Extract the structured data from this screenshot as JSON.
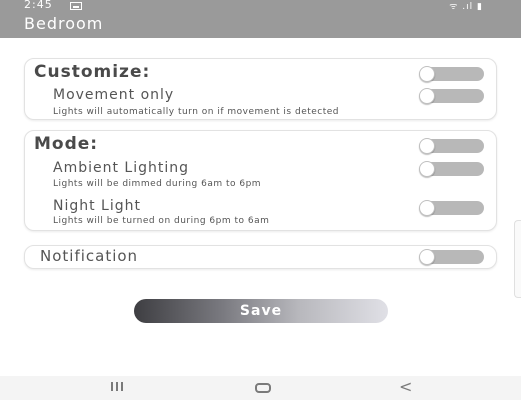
{
  "status_bar": {
    "time": "2:45",
    "right_icons": "ᯤ .ıl ▮"
  },
  "app_bar": {
    "title": "Bedroom"
  },
  "customize": {
    "title": "Customize:",
    "title_toggle_on": false,
    "movement": {
      "label": "Movement only",
      "description": "Lights will automatically turn on if movement is detected",
      "on": false
    }
  },
  "mode": {
    "title": "Mode:",
    "title_toggle_on": false,
    "ambient": {
      "label": "Ambient Lighting",
      "description": "Lights will be dimmed during 6am to 6pm",
      "on": false
    },
    "night": {
      "label": "Night Light",
      "description": "Lights will be turned on during 6pm to 6am",
      "on": false
    }
  },
  "notification": {
    "label": "Notification",
    "on": false
  },
  "save_button": {
    "label": "Save"
  },
  "colors": {
    "app_bar": "#9a9a9a",
    "toggle_track": "#b8b8b8",
    "save_gradient_start": "#3e3e42",
    "save_gradient_end": "#e0e0e6"
  },
  "nav_bar": {
    "back_glyph": "<"
  }
}
